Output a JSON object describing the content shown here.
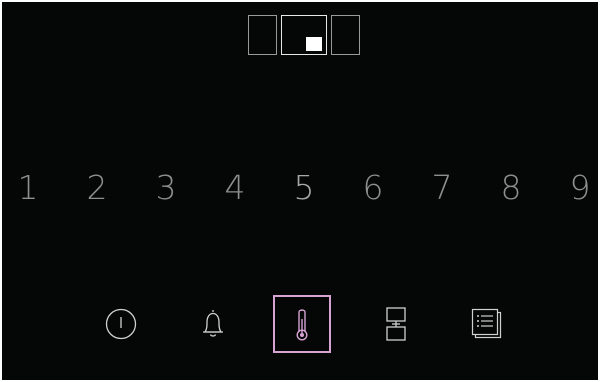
{
  "zones": {
    "selected": "middle",
    "items": [
      "left",
      "middle",
      "right"
    ]
  },
  "power_levels": {
    "items": [
      "1",
      "2",
      "3",
      "4",
      "5",
      "6",
      "7",
      "8",
      "9"
    ]
  },
  "toolbar": {
    "items": [
      {
        "icon": "power-icon",
        "selected": false
      },
      {
        "icon": "bell-icon",
        "selected": false
      },
      {
        "icon": "thermometer-icon",
        "selected": true
      },
      {
        "icon": "bridge-zone-icon",
        "selected": false
      },
      {
        "icon": "menu-list-icon",
        "selected": false
      }
    ]
  },
  "colors": {
    "background": "#050707",
    "level_text": "#8f8f8f",
    "icon_stroke": "#d0d0d0",
    "selected_accent": "#d6a3d3"
  }
}
